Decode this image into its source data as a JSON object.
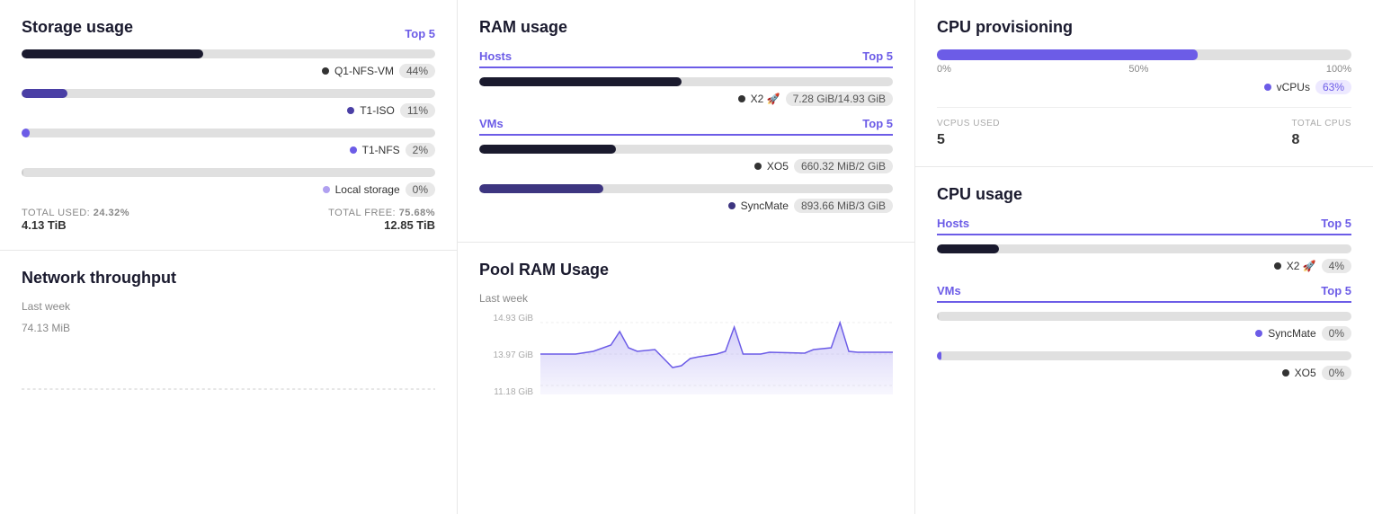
{
  "storage": {
    "title": "Storage usage",
    "top_link": "Top 5",
    "items": [
      {
        "name": "Q1-NFS-VM",
        "pct": 44,
        "pct_label": "44%",
        "color": "#1a1a2e",
        "dot_color": "#333"
      },
      {
        "name": "T1-ISO",
        "pct": 11,
        "pct_label": "11%",
        "color": "#4a3fa5",
        "dot_color": "#4a3fa5"
      },
      {
        "name": "T1-NFS",
        "pct": 2,
        "pct_label": "2%",
        "color": "#6c5ce7",
        "dot_color": "#6c5ce7"
      },
      {
        "name": "Local storage",
        "pct": 0,
        "pct_label": "0%",
        "color": "#ccc",
        "dot_color": "#b0a0f0"
      }
    ],
    "total_used_label": "TOTAL USED:",
    "total_used_pct": "24.32%",
    "total_used_val": "4.13 TiB",
    "total_free_label": "TOTAL FREE:",
    "total_free_pct": "75.68%",
    "total_free_val": "12.85 TiB"
  },
  "network": {
    "title": "Network throughput",
    "subtitle": "Last week",
    "value": "74.13 MiB"
  },
  "ram": {
    "title": "RAM usage",
    "hosts_label": "Hosts",
    "hosts_top": "Top 5",
    "hosts": [
      {
        "name": "X2 🚀",
        "value": "7.28 GiB/14.93 GiB",
        "pct": 49,
        "color": "#1a1a2e",
        "dot_color": "#333"
      }
    ],
    "vms_label": "VMs",
    "vms_top": "Top 5",
    "vms": [
      {
        "name": "XO5",
        "value": "660.32 MiB/2 GiB",
        "pct": 33,
        "color": "#1a1a2e",
        "dot_color": "#333"
      },
      {
        "name": "SyncMate",
        "value": "893.66 MiB/3 GiB",
        "pct": 30,
        "color": "#3d3580",
        "dot_color": "#3d3580"
      }
    ]
  },
  "pool_ram": {
    "title": "Pool RAM Usage",
    "subtitle": "Last week",
    "labels": [
      "14.93 GiB",
      "13.97 GiB",
      "11.18 GiB"
    ]
  },
  "cpu_prov": {
    "title": "CPU provisioning",
    "bar_pct": 63,
    "bar_color": "#6c5ce7",
    "label_0": "0%",
    "label_50": "50%",
    "label_100": "100%",
    "vcpus_label": "vCPUs",
    "vcpus_pct": "63%",
    "vcpus_dot": "#6c5ce7",
    "stat1_label": "VCPUS USED",
    "stat1_val": "5",
    "stat2_label": "TOTAL CPUS",
    "stat2_val": "8"
  },
  "cpu_usage": {
    "title": "CPU usage",
    "hosts_label": "Hosts",
    "hosts_top": "Top 5",
    "hosts": [
      {
        "name": "X2 🚀",
        "value": "4%",
        "pct": 15,
        "color": "#1a1a2e",
        "dot_color": "#333"
      }
    ],
    "vms_label": "VMs",
    "vms_top": "Top 5",
    "vms": [
      {
        "name": "SyncMate",
        "value": "0%",
        "pct": 0,
        "color": "#ccc",
        "dot_color": "#6c5ce7"
      },
      {
        "name": "XO5",
        "value": "0%",
        "pct": 1,
        "color": "#6c5ce7",
        "dot_color": "#333"
      }
    ]
  }
}
